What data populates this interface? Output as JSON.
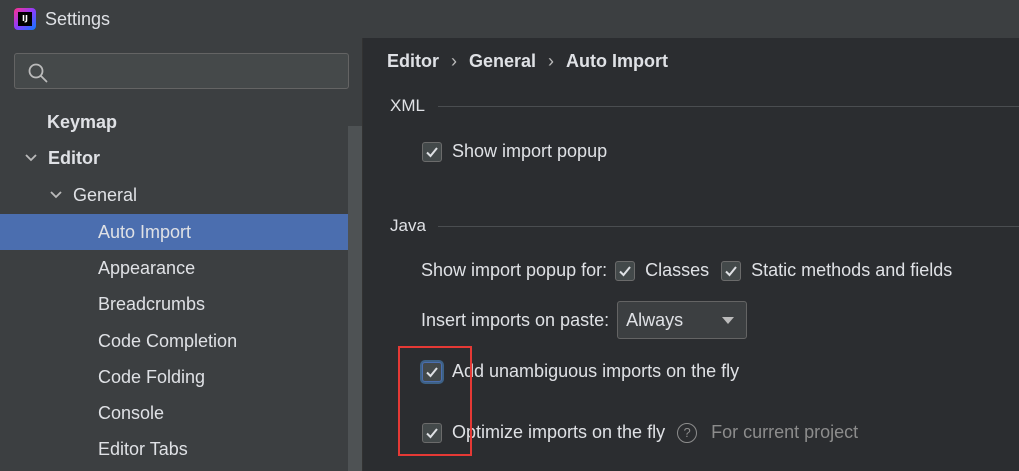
{
  "window": {
    "title": "Settings",
    "app_icon_label": "IJ"
  },
  "search": {
    "placeholder": ""
  },
  "sidebar": {
    "items": [
      {
        "label": "Keymap"
      },
      {
        "label": "Editor"
      },
      {
        "label": "General"
      },
      {
        "label": "Auto Import"
      },
      {
        "label": "Appearance"
      },
      {
        "label": "Breadcrumbs"
      },
      {
        "label": "Code Completion"
      },
      {
        "label": "Code Folding"
      },
      {
        "label": "Console"
      },
      {
        "label": "Editor Tabs"
      }
    ]
  },
  "breadcrumb": {
    "parts": [
      "Editor",
      "General",
      "Auto Import"
    ],
    "separator": "›"
  },
  "xml": {
    "group_title": "XML",
    "show_import_popup": {
      "label": "Show import popup",
      "checked": true
    }
  },
  "java": {
    "group_title": "Java",
    "show_import_popup_for_label": "Show import popup for:",
    "classes": {
      "label": "Classes",
      "checked": true
    },
    "static_methods": {
      "label": "Static methods and fields",
      "checked": true
    },
    "insert_imports_label": "Insert imports on paste:",
    "insert_imports_value": "Always",
    "add_unambiguous": {
      "label": "Add unambiguous imports on the fly",
      "checked": true
    },
    "optimize_imports": {
      "label": "Optimize imports on the fly",
      "checked": true
    },
    "optimize_hint": "For current project"
  },
  "colors": {
    "selection": "#4b6eaf",
    "highlight_box": "#e53935",
    "background": "#2b2d30",
    "sidebar": "#3c3f41"
  }
}
